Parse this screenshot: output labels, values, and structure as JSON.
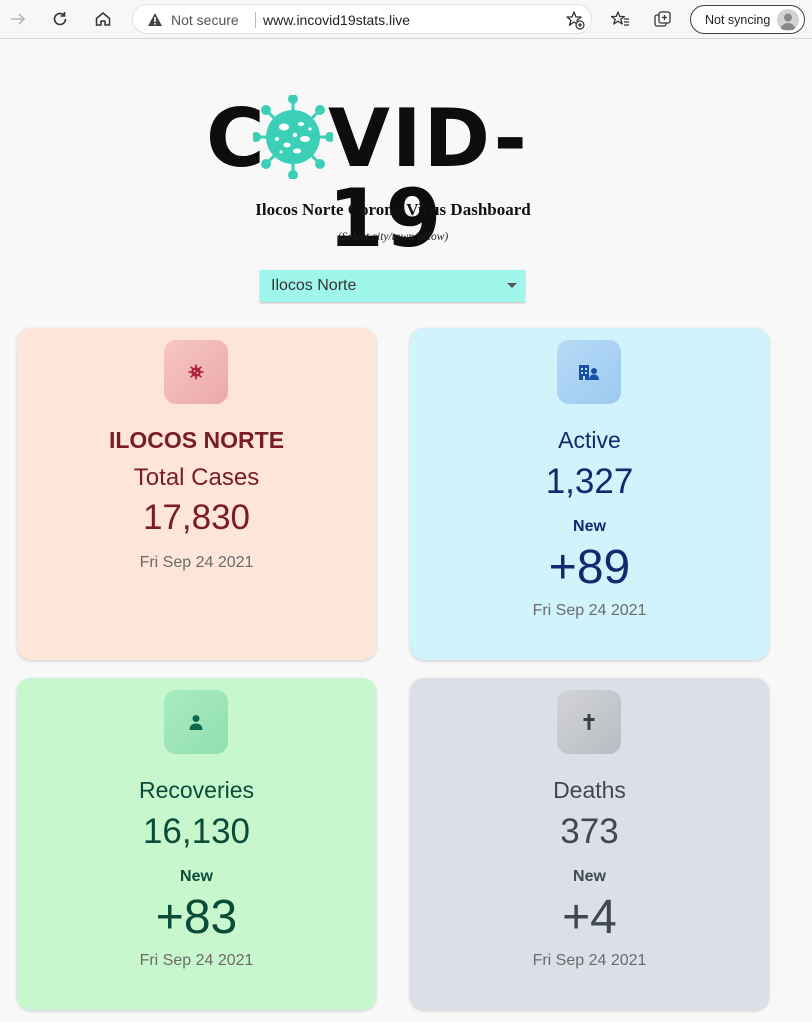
{
  "browser": {
    "address_warning": "Not secure",
    "url": "www.incovid19stats.live",
    "sync_label": "Not syncing"
  },
  "logo": {
    "text_left": "C",
    "text_right": "VID-19",
    "virus_color": "#3ccfb8"
  },
  "header": {
    "title": "Ilocos Norte Corona Virus Dashboard",
    "subtitle": "(Select city/town below)"
  },
  "selector": {
    "value": "Ilocos Norte",
    "color": "#9ff7eb"
  },
  "cards": {
    "total": {
      "region": "ILOCOS NORTE",
      "label": "Total Cases",
      "value": "17,830",
      "date": "Fri Sep 24 2021"
    },
    "active": {
      "label": "Active",
      "value": "1,327",
      "new_label": "New",
      "new_value": "+89",
      "date": "Fri Sep 24 2021"
    },
    "recoveries": {
      "label": "Recoveries",
      "value": "16,130",
      "new_label": "New",
      "new_value": "+83",
      "date": "Fri Sep 24 2021"
    },
    "deaths": {
      "label": "Deaths",
      "value": "373",
      "new_label": "New",
      "new_value": "+4",
      "date": "Fri Sep 24 2021"
    }
  },
  "icons": {
    "total": "virus-icon",
    "active": "hospital-user-icon",
    "recoveries": "user-icon",
    "deaths": "cross-icon"
  }
}
